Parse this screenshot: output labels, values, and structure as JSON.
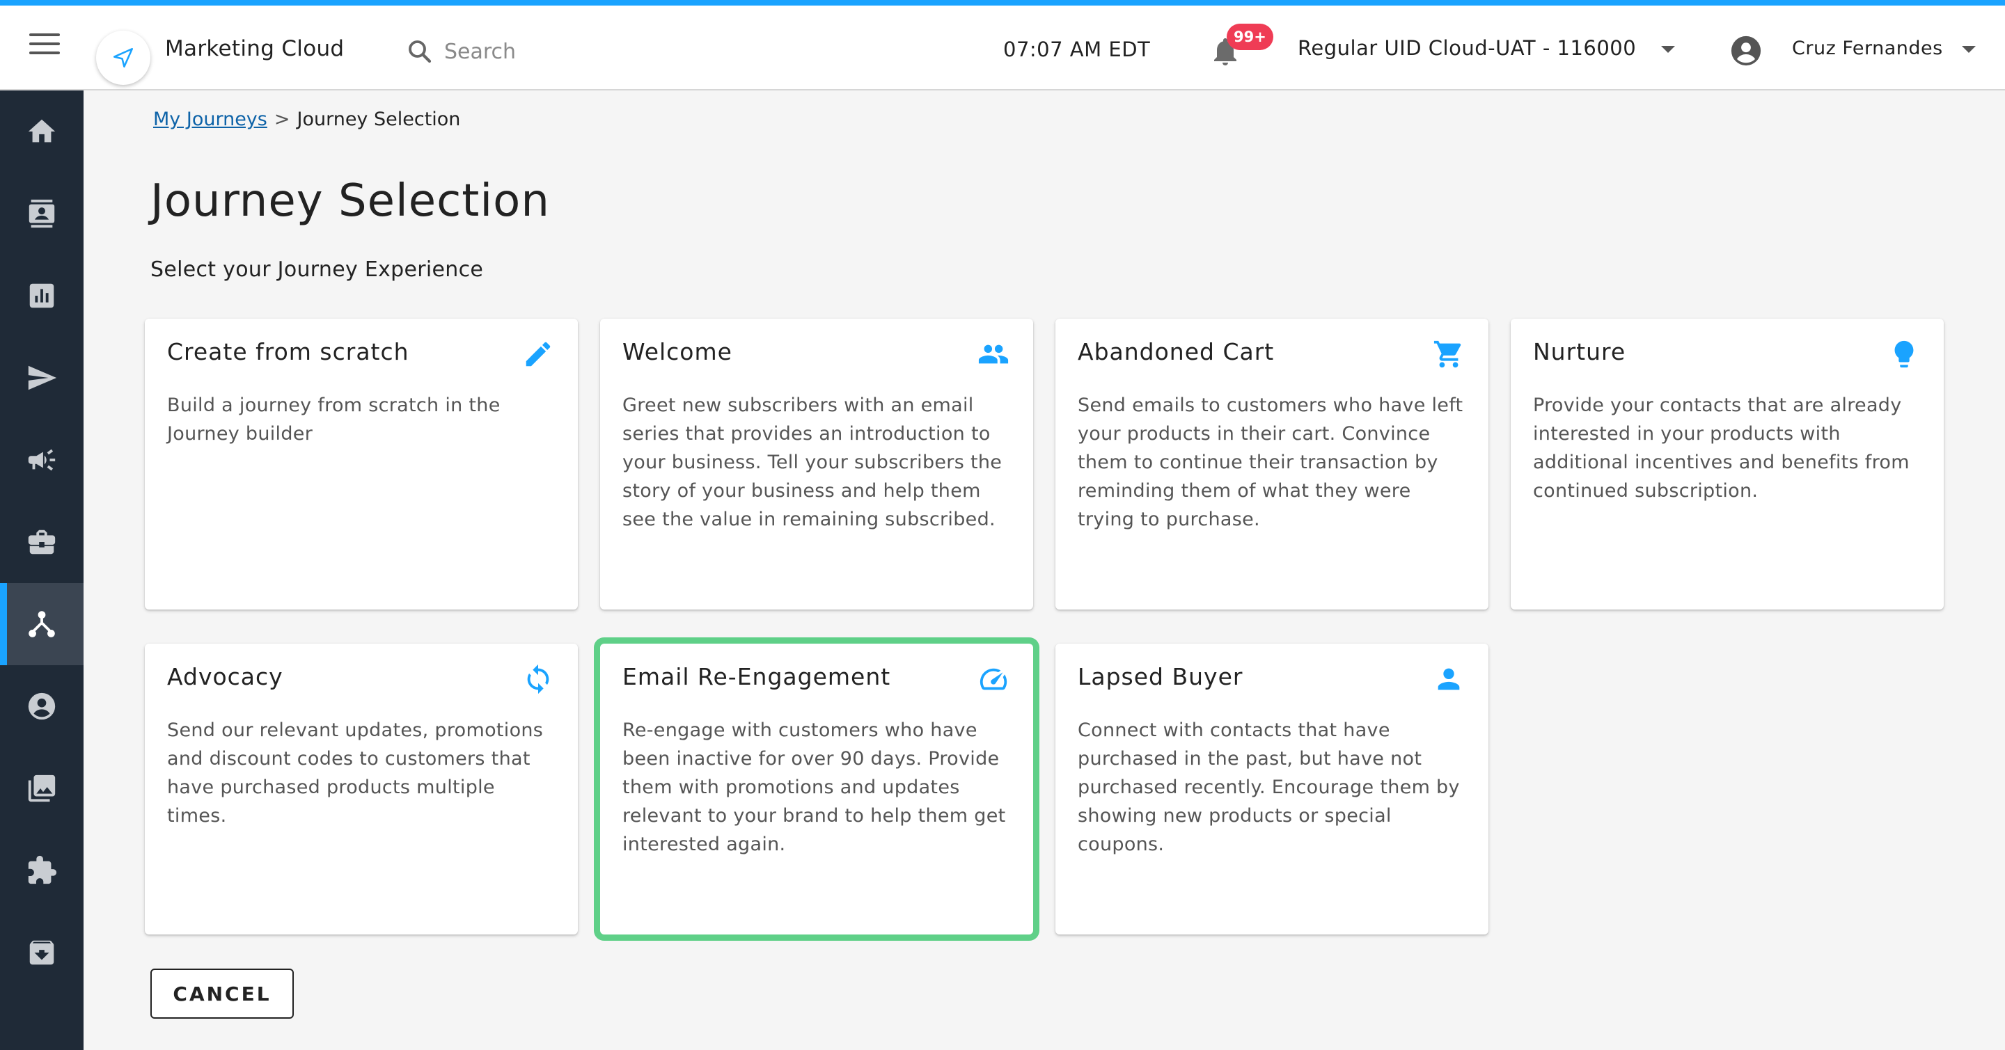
{
  "header": {
    "app_title": "Marketing Cloud",
    "search_placeholder": "Search",
    "time": "07:07 AM EDT",
    "notification_badge": "99+",
    "account": "Regular UID Cloud-UAT - 116000",
    "user_name": "Cruz Fernandes"
  },
  "sidebar": {
    "items": [
      {
        "icon": "home-icon"
      },
      {
        "icon": "contacts-icon"
      },
      {
        "icon": "reports-icon"
      },
      {
        "icon": "send-icon"
      },
      {
        "icon": "campaign-icon"
      },
      {
        "icon": "briefcase-icon"
      },
      {
        "icon": "journeys-icon",
        "active": true
      },
      {
        "icon": "account-icon"
      },
      {
        "icon": "media-library-icon"
      },
      {
        "icon": "integrations-icon"
      },
      {
        "icon": "archive-icon"
      }
    ]
  },
  "breadcrumb": {
    "link": "My Journeys",
    "separator": ">",
    "current": "Journey Selection"
  },
  "page": {
    "title": "Journey Selection",
    "subtitle": "Select your Journey Experience"
  },
  "cards": [
    {
      "title": "Create from scratch",
      "icon": "pencil-icon",
      "description": "Build a journey from scratch in the Journey builder"
    },
    {
      "title": "Welcome",
      "icon": "people-icon",
      "description": "Greet new subscribers with an email series that provides an introduction to your business. Tell your subscribers the story of your business and help them see the value in remaining subscribed."
    },
    {
      "title": "Abandoned Cart",
      "icon": "cart-icon",
      "description": "Send emails to customers who have left your products in their cart. Convince them to continue their transaction by reminding them of what they were trying to purchase."
    },
    {
      "title": "Nurture",
      "icon": "lightbulb-icon",
      "description": "Provide your contacts that are already interested in your products with additional incentives and benefits from continued subscription."
    },
    {
      "title": "Advocacy",
      "icon": "refresh-icon",
      "description": "Send our relevant updates, promotions and discount codes to customers that have purchased products multiple times."
    },
    {
      "title": "Email Re-Engagement",
      "icon": "speedometer-icon",
      "description": "Re-engage with customers who have been inactive for over 90 days. Provide them with promotions and updates relevant to your brand to help them get interested again.",
      "selected": true
    },
    {
      "title": "Lapsed Buyer",
      "icon": "person-icon",
      "description": "Connect with contacts that have purchased in the past, but have not purchased recently. Encourage them by showing new products or special coupons."
    }
  ],
  "actions": {
    "cancel_label": "CANCEL"
  },
  "colors": {
    "accent": "#1aa3ff",
    "sidebar": "#1f2a37",
    "selected_border": "#5fd088",
    "badge": "#ef3c55",
    "link": "#0e63a8"
  }
}
